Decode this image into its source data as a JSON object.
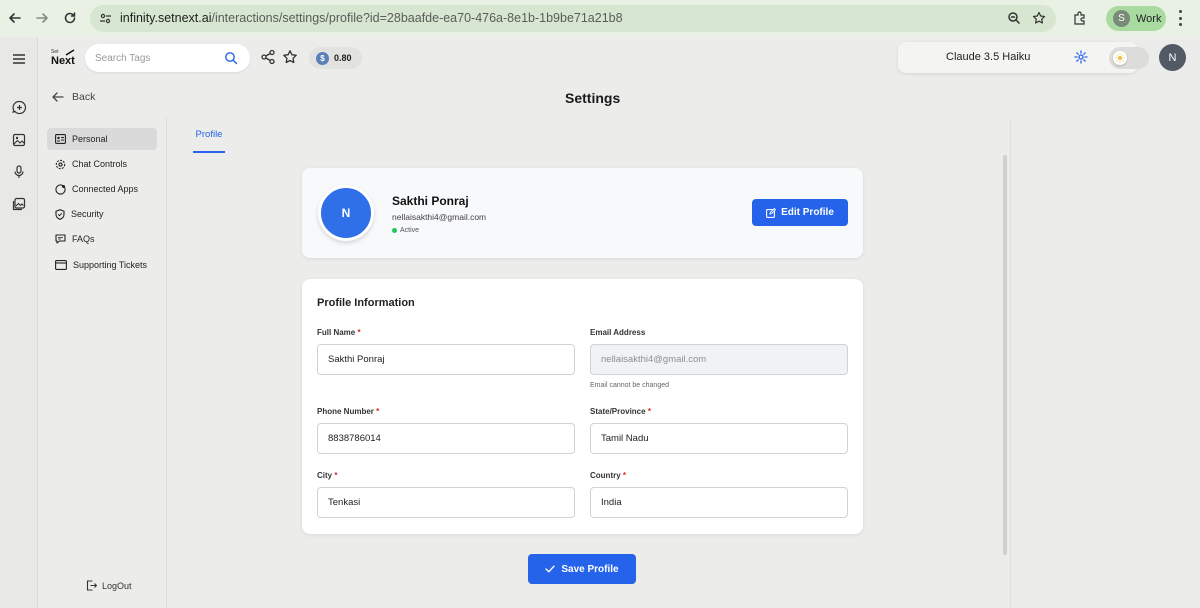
{
  "browser": {
    "url_host": "infinity.setnext.ai",
    "url_path": "/interactions/settings/profile?id=28baafde-ea70-476a-8e1b-1b9be71a21b8",
    "profile_initial": "S",
    "profile_label": "Work"
  },
  "header": {
    "logo_small": "Set",
    "logo_text": "Next",
    "search_placeholder": "Search Tags",
    "credit_symbol": "$",
    "credit_value": "0.80",
    "model_name": "Claude 3.5 Haiku",
    "user_initial": "N"
  },
  "page": {
    "back_label": "Back",
    "title": "Settings"
  },
  "sidebar": {
    "items": [
      {
        "label": "Personal",
        "icon": "id-card-icon"
      },
      {
        "label": "Chat Controls",
        "icon": "gear-icon"
      },
      {
        "label": "Connected Apps",
        "icon": "apps-icon"
      },
      {
        "label": "Security",
        "icon": "shield-icon"
      },
      {
        "label": "FAQs",
        "icon": "chat-icon"
      },
      {
        "label": "Supporting Tickets",
        "icon": "ticket-icon"
      }
    ],
    "logout_label": "LogOut"
  },
  "tabs": {
    "profile": "Profile"
  },
  "profile": {
    "initial": "N",
    "name": "Sakthi Ponraj",
    "email": "nellaisakthi4@gmail.com",
    "status": "Active",
    "edit_label": "Edit Profile"
  },
  "form": {
    "title": "Profile Information",
    "full_name_label": "Full Name",
    "full_name_value": "Sakthi Ponraj",
    "email_label": "Email Address",
    "email_value": "nellaisakthi4@gmail.com",
    "email_help": "Email cannot be changed",
    "phone_label": "Phone Number",
    "phone_value": "8838786014",
    "state_label": "State/Province",
    "state_value": "Tamil Nadu",
    "city_label": "City",
    "city_value": "Tenkasi",
    "country_label": "Country",
    "country_value": "India",
    "required_mark": "*",
    "save_label": "Save Profile"
  },
  "colors": {
    "primary": "#2563eb",
    "active_dot": "#22c55e",
    "required": "#dc2626"
  }
}
